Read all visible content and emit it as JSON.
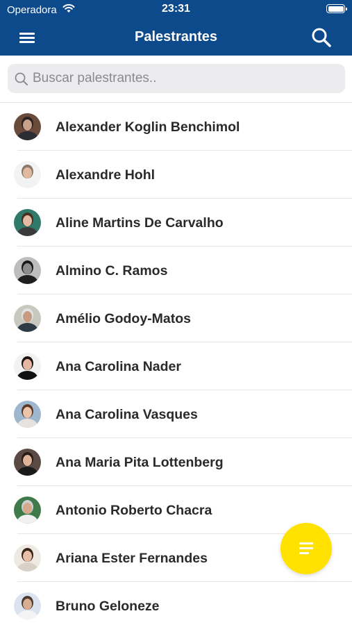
{
  "status_bar": {
    "carrier": "Operadora",
    "time": "23:31",
    "wifi_icon": "wifi-icon",
    "battery_icon": "battery-icon"
  },
  "nav": {
    "title": "Palestrantes",
    "menu_icon": "hamburger-menu-icon",
    "search_icon": "search-icon",
    "background_color": "#0c4a8c"
  },
  "search": {
    "placeholder": "Buscar palestrantes..",
    "value": ""
  },
  "speakers": [
    {
      "name": "Alexander Koglin Benchimol",
      "avatar_bg": "#6a4a3a",
      "shirt": "#2c2c34",
      "skin": "#c9a08a",
      "hair": "#2a2220"
    },
    {
      "name": "Alexandre Hohl",
      "avatar_bg": "#f3f3f3",
      "shirt": "#f2f2f2",
      "skin": "#e0b99e",
      "hair": "#8a7a6a"
    },
    {
      "name": "Aline Martins De Carvalho",
      "avatar_bg": "#2f7a68",
      "shirt": "#3b3b3b",
      "skin": "#e3bca4",
      "hair": "#4a2e22"
    },
    {
      "name": "Almino C. Ramos",
      "avatar_bg": "#bdbdbd",
      "shirt": "#1e1e1e",
      "skin": "#8c8c8c",
      "hair": "#1a1a1a"
    },
    {
      "name": "Amélio Godoy-Matos",
      "avatar_bg": "#c8c8c0",
      "shirt": "#2e3a44",
      "skin": "#c79b82",
      "hair": "#e2e2e2"
    },
    {
      "name": "Ana Carolina Nader",
      "avatar_bg": "#f2f2f2",
      "shirt": "#111111",
      "skin": "#e4b8a0",
      "hair": "#1c1412"
    },
    {
      "name": "Ana Carolina Vasques",
      "avatar_bg": "#9fb6cf",
      "shirt": "#e8e2de",
      "skin": "#ecc3ab",
      "hair": "#5a3a26"
    },
    {
      "name": "Ana Maria Pita Lottenberg",
      "avatar_bg": "#5a4a44",
      "shirt": "#1a1a1a",
      "skin": "#e0b49a",
      "hair": "#2a1a14"
    },
    {
      "name": "Antonio Roberto Chacra",
      "avatar_bg": "#3f7a4a",
      "shirt": "#f0f0f0",
      "skin": "#d6a88c",
      "hair": "#cfcfcf"
    },
    {
      "name": "Ariana Ester Fernandes",
      "avatar_bg": "#efe9e4",
      "shirt": "#d9d0c8",
      "skin": "#e6bfa6",
      "hair": "#3a2418"
    },
    {
      "name": "Bruno Geloneze",
      "avatar_bg": "#dbe4ee",
      "shirt": "#f4f4f4",
      "skin": "#d8ad92",
      "hair": "#4a3a30"
    }
  ],
  "fab": {
    "icon": "filter-lines-icon",
    "color": "#ffe200"
  }
}
